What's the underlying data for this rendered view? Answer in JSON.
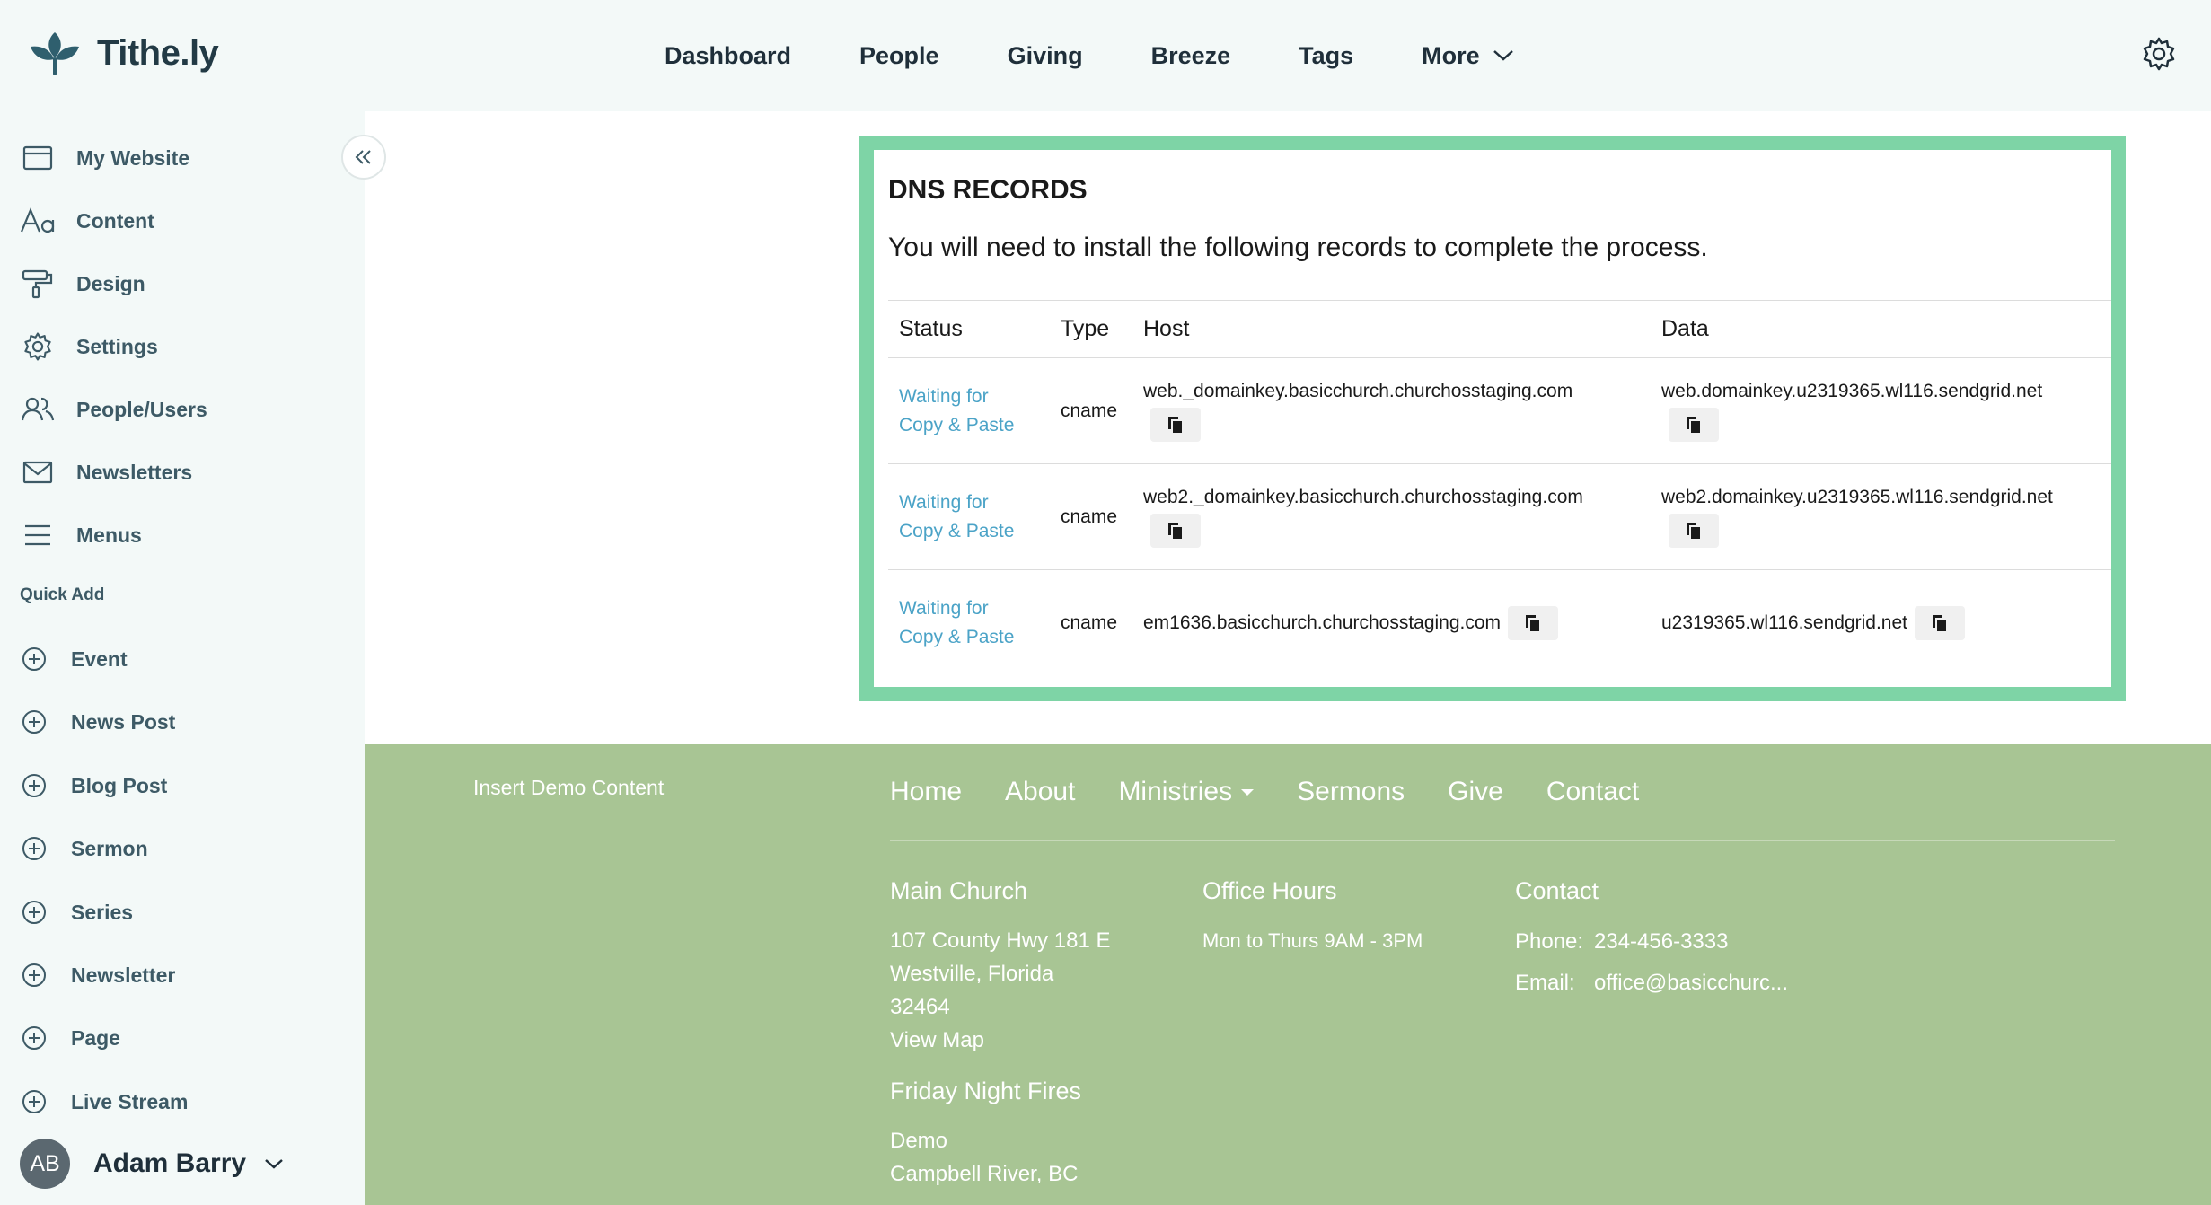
{
  "brand": {
    "name": "Tithe.ly"
  },
  "topnav": {
    "items": [
      "Dashboard",
      "People",
      "Giving",
      "Breeze",
      "Tags"
    ],
    "more": "More"
  },
  "sidebar": {
    "items": [
      {
        "label": "My Website",
        "icon": "browser-window-icon"
      },
      {
        "label": "Content",
        "icon": "text-aa-icon"
      },
      {
        "label": "Design",
        "icon": "paint-roller-icon"
      },
      {
        "label": "Settings",
        "icon": "gear-icon"
      },
      {
        "label": "People/Users",
        "icon": "users-icon"
      },
      {
        "label": "Newsletters",
        "icon": "envelope-icon"
      },
      {
        "label": "Menus",
        "icon": "hamburger-icon"
      }
    ],
    "quick_add_label": "Quick Add",
    "quick_add": [
      "Event",
      "News Post",
      "Blog Post",
      "Sermon",
      "Series",
      "Newsletter",
      "Page",
      "Live Stream"
    ],
    "user": {
      "initials": "AB",
      "name": "Adam Barry"
    }
  },
  "dns": {
    "title": "DNS RECORDS",
    "description": "You will need to install the following records to complete the process.",
    "columns": [
      "Status",
      "Type",
      "Host",
      "Data"
    ],
    "rows": [
      {
        "status_line1": "Waiting for",
        "status_line2": "Copy & Paste",
        "type": "cname",
        "host": "web._domainkey.basicchurch.churchosstaging.com",
        "data": "web.domainkey.u2319365.wl116.sendgrid.net"
      },
      {
        "status_line1": "Waiting for",
        "status_line2": "Copy & Paste",
        "type": "cname",
        "host": "web2._domainkey.basicchurch.churchosstaging.com",
        "data": "web2.domainkey.u2319365.wl116.sendgrid.net"
      },
      {
        "status_line1": "Waiting for",
        "status_line2": "Copy & Paste",
        "type": "cname",
        "host": "em1636.basicchurch.churchosstaging.com",
        "data": "u2319365.wl116.sendgrid.net"
      }
    ]
  },
  "footer": {
    "insert_demo": "Insert Demo Content",
    "nav": [
      "Home",
      "About",
      "Ministries",
      "Sermons",
      "Give",
      "Contact"
    ],
    "main_church": {
      "heading": "Main Church",
      "line1": "107 County Hwy 181 E",
      "line2": "Westville, Florida",
      "line3": "32464",
      "map": "View Map"
    },
    "office_hours": {
      "heading": "Office Hours",
      "text": "Mon to Thurs 9AM - 3PM"
    },
    "contact": {
      "heading": "Contact",
      "phone_label": "Phone:",
      "phone": "234-456-3333",
      "email_label": "Email:",
      "email": "office@basicchurc..."
    },
    "second_location": {
      "heading": "Friday Night Fires",
      "line1": "Demo",
      "line2": "Campbell River, BC"
    }
  },
  "colors": {
    "accent_border": "#7ed4a6",
    "footer_bg": "#a8c594",
    "status_link": "#4ba3c7",
    "sidebar_bg": "#f3f9f8"
  }
}
